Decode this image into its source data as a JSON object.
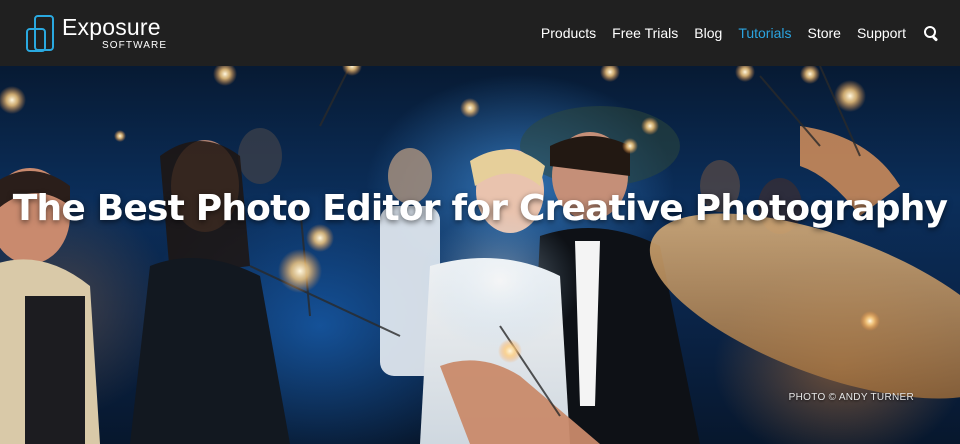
{
  "header": {
    "logo": {
      "word": "Exposure",
      "sub": "SOFTWARE"
    },
    "nav": [
      {
        "label": "Products",
        "active": false
      },
      {
        "label": "Free Trials",
        "active": false
      },
      {
        "label": "Blog",
        "active": false
      },
      {
        "label": "Tutorials",
        "active": true
      },
      {
        "label": "Store",
        "active": false
      },
      {
        "label": "Support",
        "active": false
      }
    ],
    "search_icon": "search-icon"
  },
  "hero": {
    "title": "The Best Photo Editor for Creative Photography",
    "credit": "PHOTO © ANDY TURNER"
  },
  "colors": {
    "header_bg": "#202020",
    "accent": "#2ba4e0",
    "text": "#ffffff"
  }
}
